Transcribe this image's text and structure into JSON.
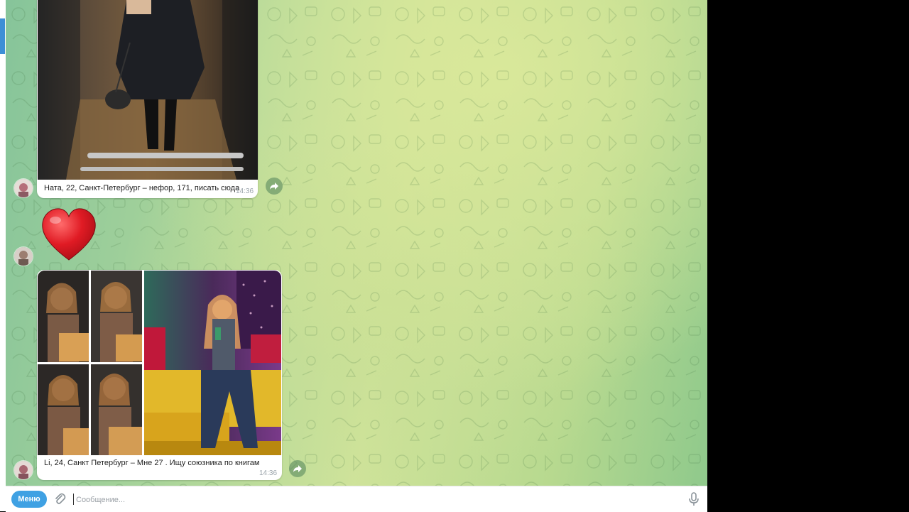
{
  "messages": [
    {
      "type": "photo",
      "caption": "Ната, 22, Санкт-Петербург – нефор, 171, писать сюда",
      "time": "14:36"
    },
    {
      "type": "sticker",
      "sticker": "red-heart"
    },
    {
      "type": "album",
      "caption": "Li, 24, Санкт Петербург – Мне 27 . Ищу союзника по книгам",
      "time": "14:36"
    }
  ],
  "input": {
    "menu_label": "Меню",
    "placeholder": "Сообщение...",
    "value": ""
  },
  "icons": {
    "attach": "paperclip-icon",
    "mic": "microphone-icon",
    "share": "forward-arrow-icon"
  },
  "colors": {
    "accent": "#3fa1e3",
    "bubble": "#ffffff",
    "heart": "#e01b24"
  }
}
